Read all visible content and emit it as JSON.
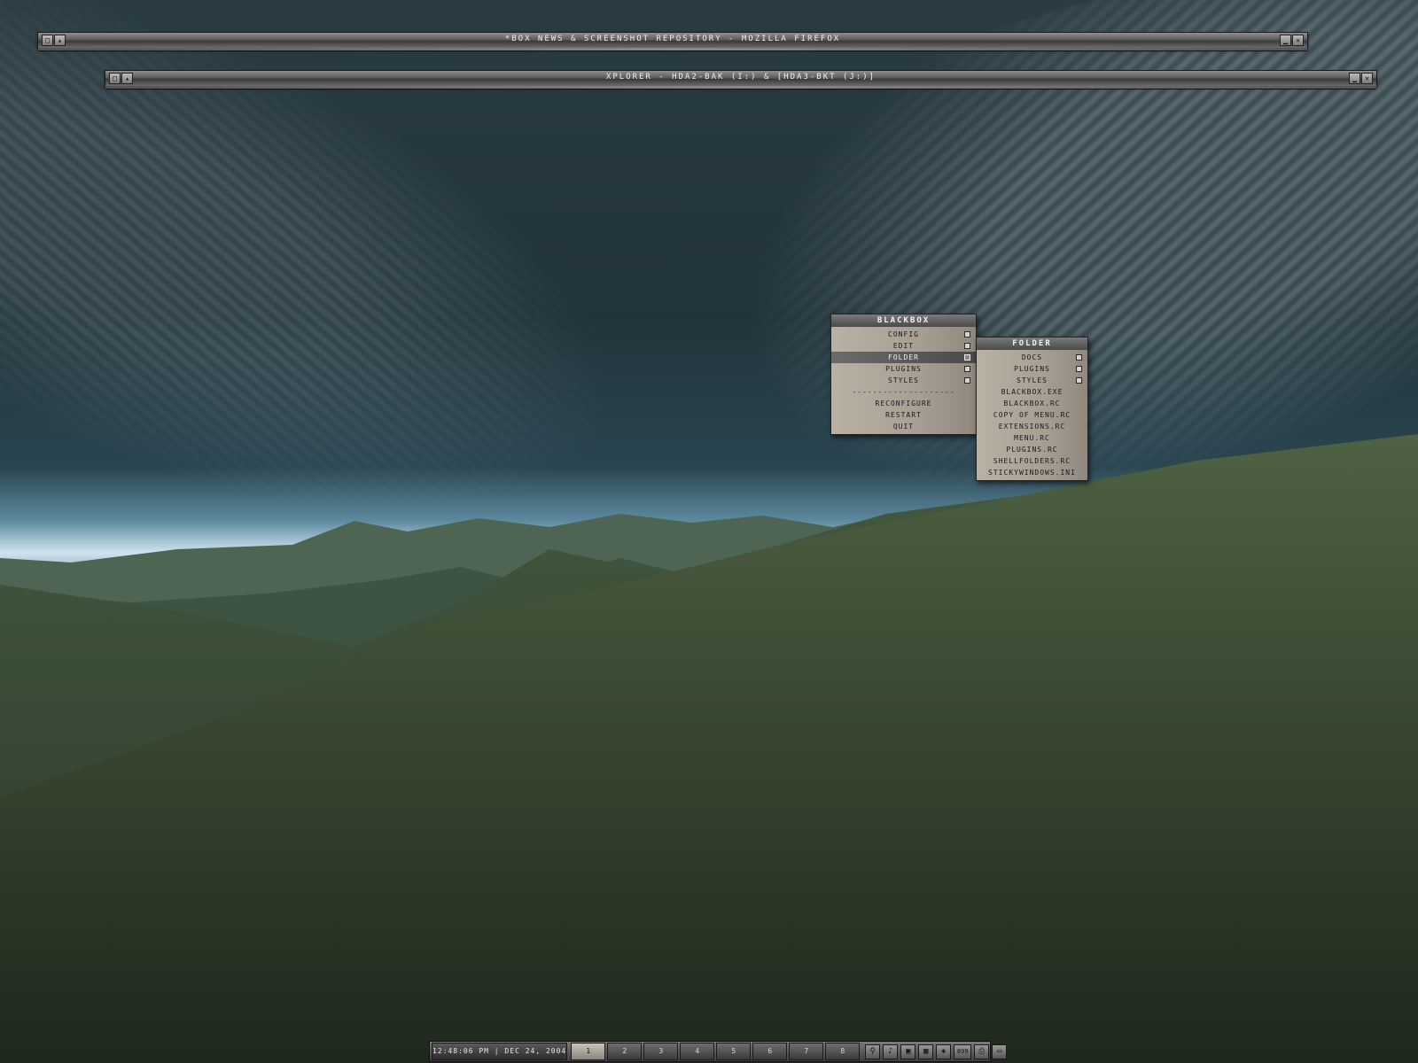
{
  "windows": {
    "firefox": {
      "title": "*BOX NEWS & SCREENSHOT REPOSITORY - MOZILLA FIREFOX"
    },
    "xplorer": {
      "title": "XPLORER  - HDA2-BAK (I:) & [HDA3-BKT (J:)]"
    }
  },
  "blackbox_menu": {
    "title": "BLACKBOX",
    "items": [
      {
        "label": "CONFIG"
      },
      {
        "label": "EDIT"
      },
      {
        "label": "FOLDER"
      },
      {
        "label": "PLUGINS"
      },
      {
        "label": "STYLES"
      },
      {
        "label": "RECONFIGURE"
      },
      {
        "label": "RESTART"
      },
      {
        "label": "QUIT"
      }
    ],
    "separator": "--------------------"
  },
  "folder_menu": {
    "title": "FOLDER",
    "items": [
      {
        "label": "DOCS"
      },
      {
        "label": "PLUGINS"
      },
      {
        "label": "STYLES"
      },
      {
        "label": "BLACKBOX.EXE"
      },
      {
        "label": "BLACKBOX.RC"
      },
      {
        "label": "COPY OF MENU.RC"
      },
      {
        "label": "EXTENSIONS.RC"
      },
      {
        "label": "MENU.RC"
      },
      {
        "label": "PLUGINS.RC"
      },
      {
        "label": "SHELLFOLDERS.RC"
      },
      {
        "label": "STICKYWINDOWS.INI"
      }
    ]
  },
  "toolbar": {
    "clock": "12:48:06 PM | DEC 24, 2004",
    "workspaces": [
      "1",
      "2",
      "3",
      "4",
      "5",
      "6",
      "7",
      "8"
    ],
    "active_workspace": "1",
    "tray_icons": [
      "network-icon",
      "speaker-icon",
      "tv-icon",
      "grid-icon",
      "shield-icon",
      "sysmon-icon",
      "printer-icon",
      "window-icon"
    ],
    "tray_text": "899"
  },
  "colors": {
    "menu_body": "#a79f93",
    "menu_title": "#4a4a4a",
    "titlebar": "#5d5d5d"
  }
}
